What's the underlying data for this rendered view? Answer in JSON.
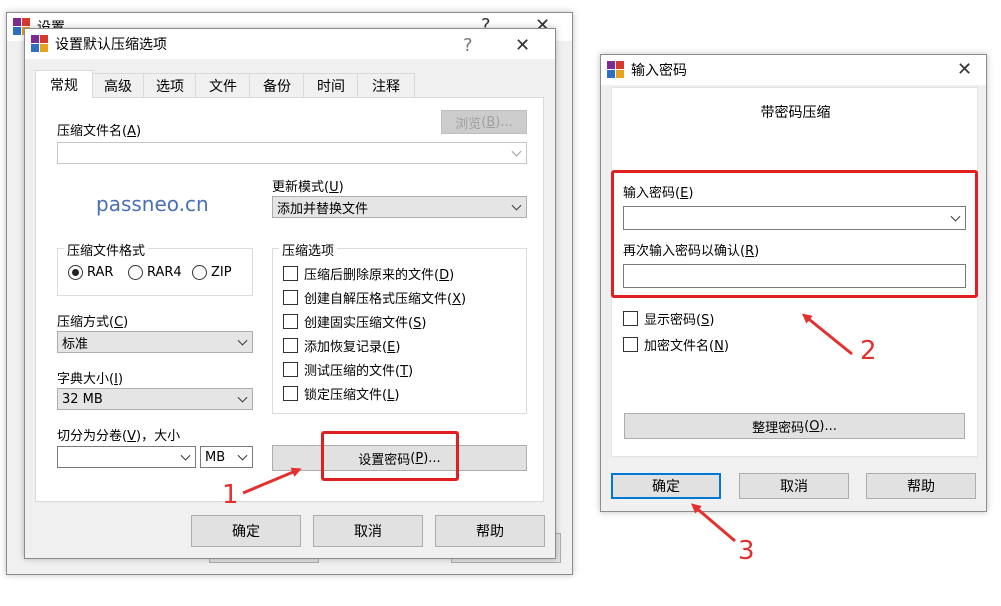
{
  "back_window": {
    "title": "设置",
    "help_glyph": "?",
    "close_glyph": "✕"
  },
  "main_dialog": {
    "title": "设置默认压缩选项",
    "help_glyph": "?",
    "close_glyph": "✕",
    "tabs": [
      "常规",
      "高级",
      "选项",
      "文件",
      "备份",
      "时间",
      "注释"
    ],
    "archive_name_label": "压缩文件名",
    "archive_name_key": "A",
    "browse_label": "浏览",
    "browse_key": "B",
    "browse_suffix": "...",
    "watermark": "passneo.cn",
    "update_mode_label": "更新模式",
    "update_mode_key": "U",
    "update_mode_value": "添加并替换文件",
    "format_group_label": "压缩文件格式",
    "formats": [
      "RAR",
      "RAR4",
      "ZIP"
    ],
    "method_label": "压缩方式",
    "method_key": "C",
    "method_value": "标准",
    "dict_label": "字典大小",
    "dict_key": "I",
    "dict_value": "32 MB",
    "split_label_prefix": "切分为分卷",
    "split_key": "V",
    "split_label_suffix": "，大小",
    "unit_value": "MB",
    "options_group_label": "压缩选项",
    "options": [
      {
        "label": "压缩后删除原来的文件",
        "key": "D"
      },
      {
        "label": "创建自解压格式压缩文件",
        "key": "X"
      },
      {
        "label": "创建固实压缩文件",
        "key": "S"
      },
      {
        "label": "添加恢复记录",
        "key": "E"
      },
      {
        "label": "测试压缩的文件",
        "key": "T"
      },
      {
        "label": "锁定压缩文件",
        "key": "L"
      }
    ],
    "set_password_label": "设置密码",
    "set_password_key": "P",
    "set_password_suffix": "...",
    "ok_label": "确定",
    "cancel_label": "取消",
    "help_label": "帮助"
  },
  "password_dialog": {
    "title": "输入密码",
    "close_glyph": "✕",
    "heading": "带密码压缩",
    "enter_label": "输入密码",
    "enter_key": "E",
    "confirm_label": "再次输入密码以确认",
    "confirm_key": "R",
    "show_password_label": "显示密码",
    "show_password_key": "S",
    "encrypt_names_label": "加密文件名",
    "encrypt_names_key": "N",
    "organize_label": "整理密码",
    "organize_key": "O",
    "organize_suffix": "...",
    "ok_label": "确定",
    "cancel_label": "取消",
    "help_label": "帮助"
  },
  "annotations": {
    "step1": "1",
    "step2": "2",
    "step3": "3"
  },
  "colors": {
    "highlight": "#e02020",
    "watermark": "#4a6fb5",
    "focus_border": "#0078d7"
  }
}
